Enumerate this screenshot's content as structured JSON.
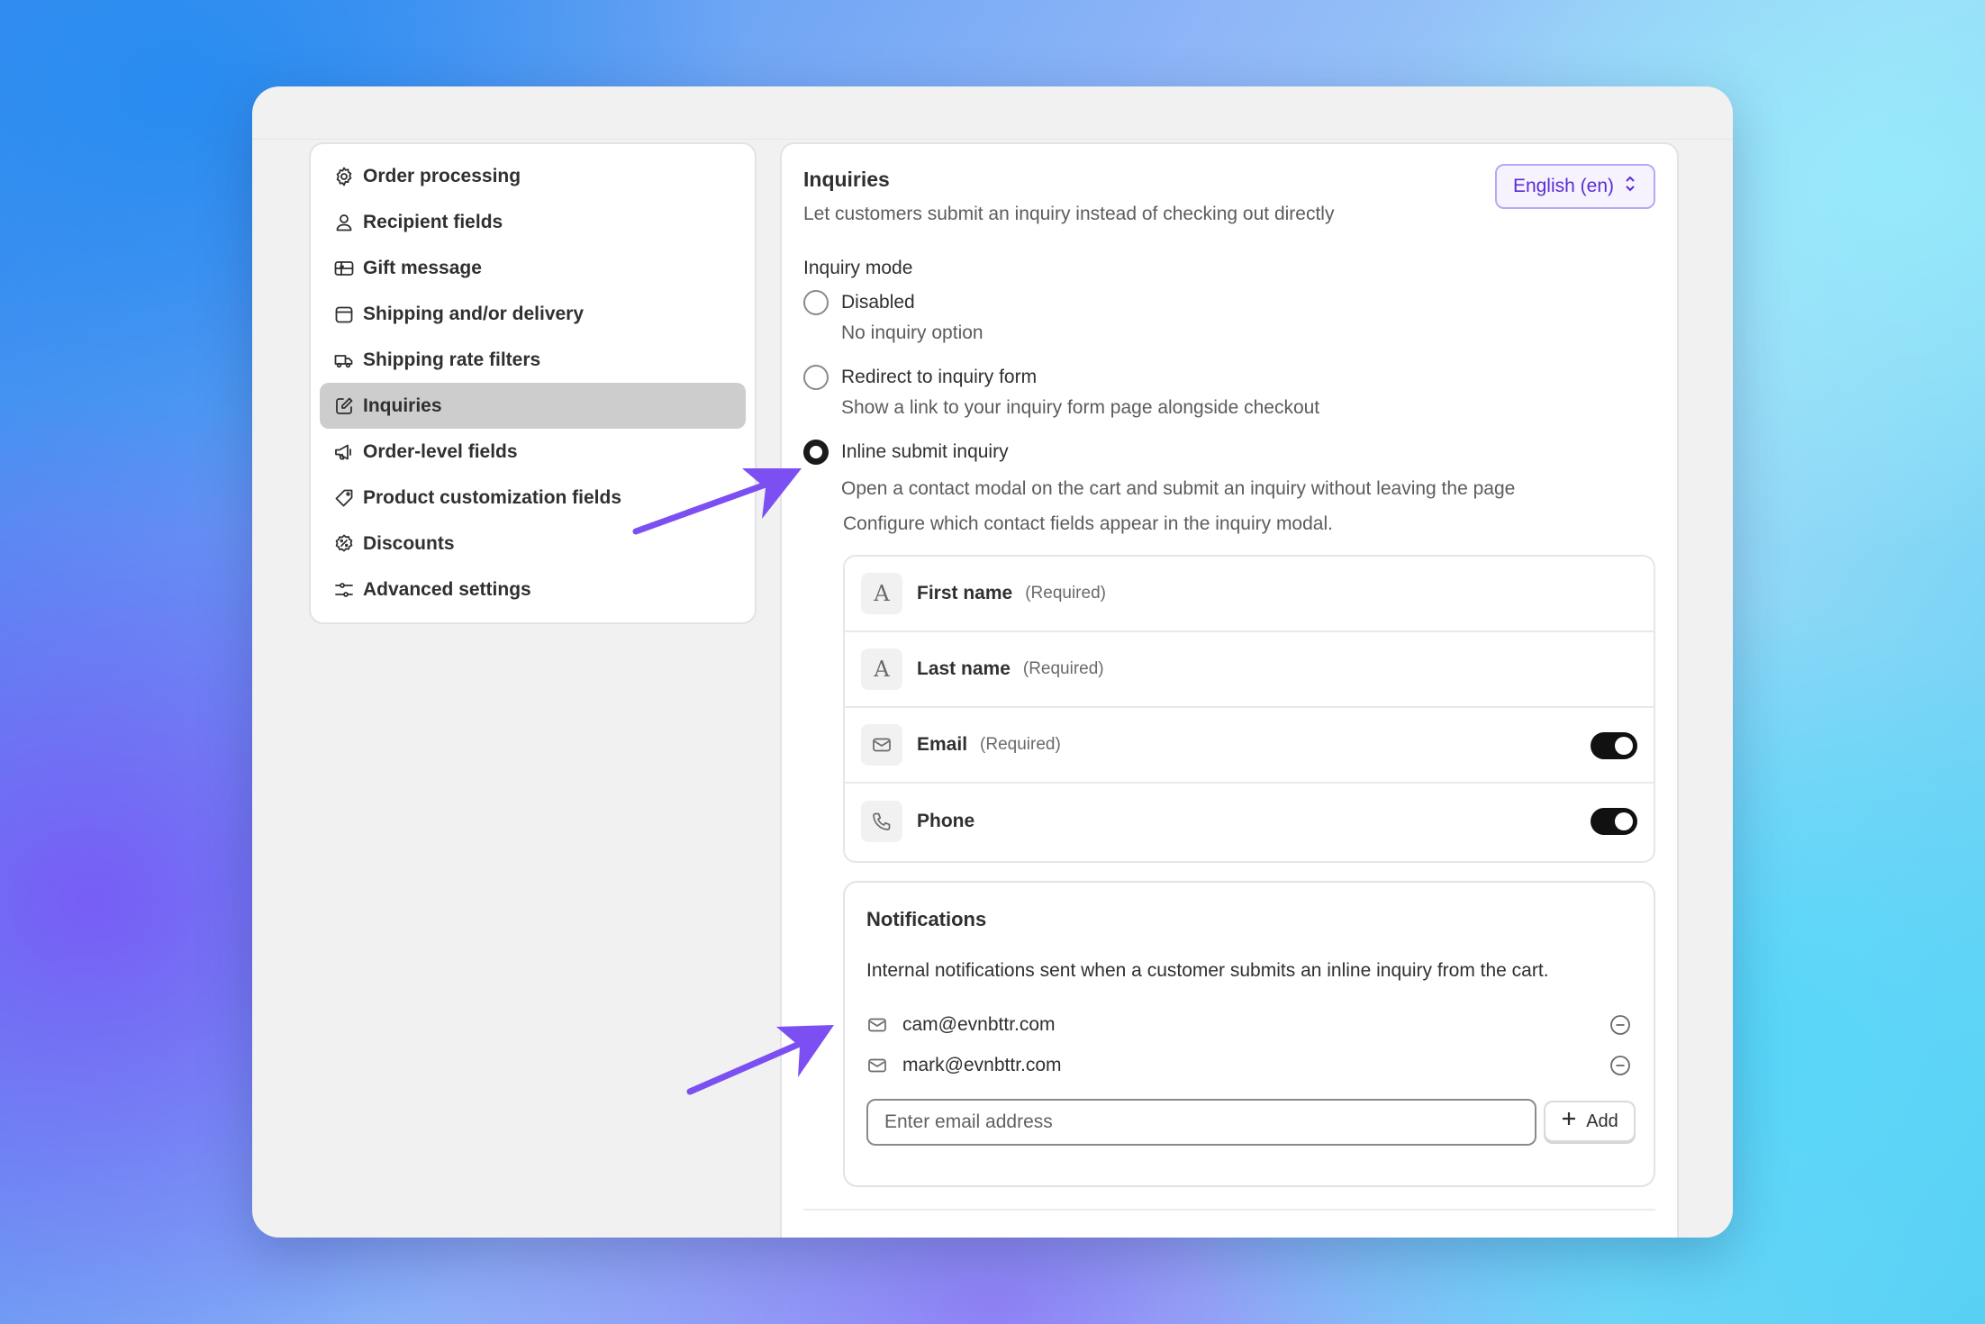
{
  "sidebar": {
    "items": [
      {
        "label": "Order processing",
        "icon": "gear-icon"
      },
      {
        "label": "Recipient fields",
        "icon": "person-icon"
      },
      {
        "label": "Gift message",
        "icon": "gift-card-icon"
      },
      {
        "label": "Shipping and/or delivery",
        "icon": "calendar-icon"
      },
      {
        "label": "Shipping rate filters",
        "icon": "truck-icon"
      },
      {
        "label": "Inquiries",
        "icon": "edit-icon",
        "active": true
      },
      {
        "label": "Order-level fields",
        "icon": "megaphone-icon"
      },
      {
        "label": "Product customization fields",
        "icon": "tag-icon"
      },
      {
        "label": "Discounts",
        "icon": "discount-icon"
      },
      {
        "label": "Advanced settings",
        "icon": "sliders-icon"
      }
    ]
  },
  "main": {
    "title": "Inquiries",
    "subtitle": "Let customers submit an inquiry instead of checking out directly",
    "language_label": "English (en)",
    "mode_label": "Inquiry mode",
    "modes": [
      {
        "label": "Disabled",
        "help": "No inquiry option",
        "checked": false
      },
      {
        "label": "Redirect to inquiry form",
        "help": "Show a link to your inquiry form page alongside checkout",
        "checked": false
      },
      {
        "label": "Inline submit inquiry",
        "help": "Open a contact modal on the cart and submit an inquiry without leaving the page",
        "checked": true
      }
    ],
    "config_note": "Configure which contact fields appear in the inquiry modal.",
    "fields": [
      {
        "name": "First name",
        "required": "(Required)",
        "icon": "text-a-icon",
        "toggle": false
      },
      {
        "name": "Last name",
        "required": "(Required)",
        "icon": "text-a-icon",
        "toggle": false
      },
      {
        "name": "Email",
        "required": "(Required)",
        "icon": "mail-icon",
        "toggle": true,
        "toggle_on": true
      },
      {
        "name": "Phone",
        "required": "",
        "icon": "phone-icon",
        "toggle": true,
        "toggle_on": true
      }
    ]
  },
  "notifications": {
    "title": "Notifications",
    "description": "Internal notifications sent when a customer submits an inline inquiry from the cart.",
    "emails": [
      "cam@evnbttr.com",
      "mark@evnbttr.com"
    ],
    "input_placeholder": "Enter email address",
    "add_label": "Add"
  },
  "colors": {
    "accent": "#5b2bd6",
    "arrow": "#7b4ff2",
    "active_nav": "#cdcdcd"
  }
}
